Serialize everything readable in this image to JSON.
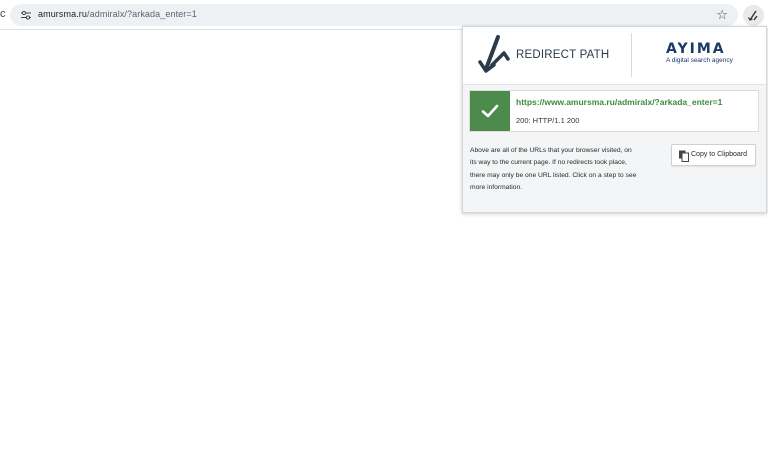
{
  "browser": {
    "back_stub": "c",
    "url_host": "amursma.ru",
    "url_path": "/admiralx/?arkada_enter=1",
    "star_icon": "star-icon",
    "extension_icon": "redirect-path-icon"
  },
  "popup": {
    "brand": "REDIRECT PATH",
    "partner_logo": "AYIMA",
    "partner_tagline": "A digital search agency",
    "result": {
      "url": "https://www.amursma.ru/admiralx/?arkada_enter=1",
      "status": "200: HTTP/1.1 200",
      "status_color": "#4c8b4c"
    },
    "description": "Above are all of the URLs that your browser visited, on its way to the current page. If no redirects took place, there may only be one URL listed. Click on a step to see more information.",
    "copy_button": "Copy to Clipboard"
  }
}
